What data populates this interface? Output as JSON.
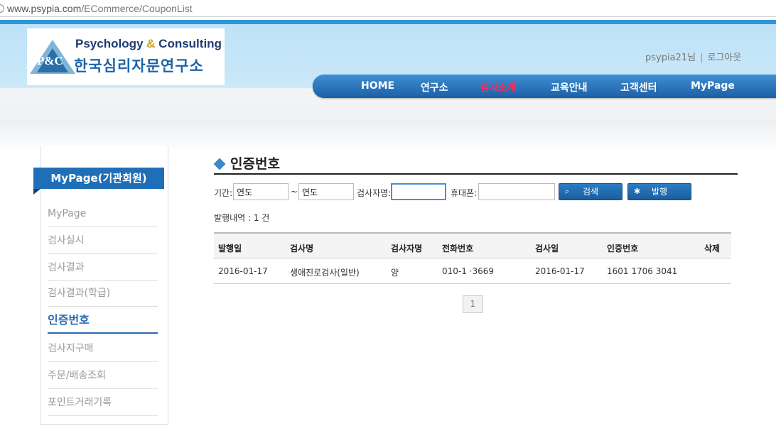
{
  "browser": {
    "url_host": "www.psypia.com",
    "url_path": "/ECommerce/CouponList"
  },
  "logo": {
    "mark": "P&C",
    "en_a": "Psychology",
    "en_amp": "&",
    "en_b": "Consulting",
    "ko": "한국심리자문연구소"
  },
  "user": {
    "name": "psypia21님",
    "sep": "|",
    "logout": "로그아웃"
  },
  "nav": [
    {
      "label": "HOME"
    },
    {
      "label": "연구소"
    },
    {
      "label": "검사소개",
      "active": true
    },
    {
      "label": "교육안내"
    },
    {
      "label": "고객센터"
    },
    {
      "label": "MyPage"
    }
  ],
  "sidebar": {
    "title": "MyPage(기관회원)",
    "items": [
      {
        "label": "MyPage"
      },
      {
        "label": "검사실시"
      },
      {
        "label": "검사결과"
      },
      {
        "label": "검사결과(학급)"
      },
      {
        "label": "인증번호",
        "active": true
      },
      {
        "label": "검사지구매"
      },
      {
        "label": "주문/배송조회"
      },
      {
        "label": "포인트거래기록"
      }
    ]
  },
  "page": {
    "title": "인증번호"
  },
  "search": {
    "period_label": "기간:",
    "from_value": "연도",
    "tilde": "~",
    "to_value": "연도",
    "examinee_label": "검사자명:",
    "examinee_value": "",
    "phone_label": "휴대폰:",
    "phone_value": "",
    "search_button": "검색",
    "issue_button": "발행"
  },
  "count_text": "발행내역 : 1 건",
  "table": {
    "headers": [
      "발행일",
      "검사명",
      "검사자명",
      "전화번호",
      "검사일",
      "인증번호",
      "삭제"
    ],
    "rows": [
      [
        "2016-01-17",
        "생애진로검사(일반)",
        "양",
        "010-1 ·3669",
        "2016-01-17",
        "1601 1706 3041",
        ""
      ]
    ]
  },
  "pagination": {
    "current": "1"
  },
  "colors": {
    "nav_active": "#ff2a55",
    "brand_blue": "#1f6fb8"
  }
}
